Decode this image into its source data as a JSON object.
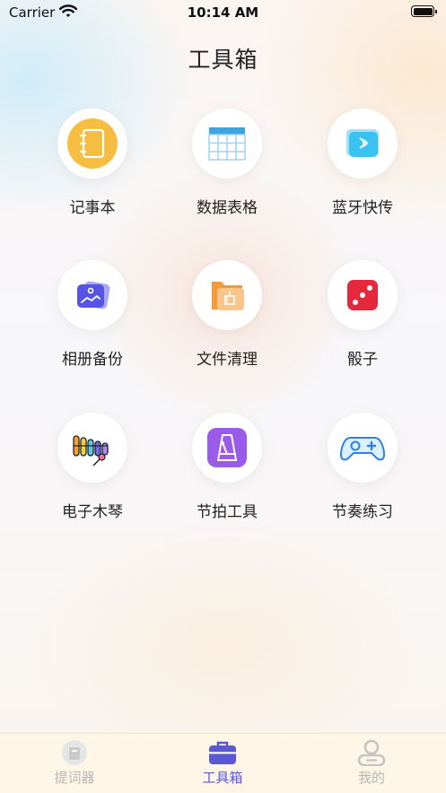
{
  "status_bar": {
    "carrier": "Carrier",
    "time": "10:14 AM"
  },
  "page": {
    "title": "工具箱"
  },
  "tools": [
    {
      "label": "记事本",
      "icon": "notebook-icon",
      "color": "#F5BE41"
    },
    {
      "label": "数据表格",
      "icon": "table-icon",
      "color": "#3FA3DE"
    },
    {
      "label": "蓝牙快传",
      "icon": "bluetooth-icon",
      "color": "#39C2F2"
    },
    {
      "label": "相册备份",
      "icon": "photo-album-icon",
      "color": "#5654E6"
    },
    {
      "label": "文件清理",
      "icon": "folder-clean-icon",
      "color": "#F39A3B"
    },
    {
      "label": "骰子",
      "icon": "dice-icon",
      "color": "#E5283B"
    },
    {
      "label": "电子木琴",
      "icon": "xylophone-icon",
      "color": "#F1A23A"
    },
    {
      "label": "节拍工具",
      "icon": "metronome-icon",
      "color": "#9A5BEA"
    },
    {
      "label": "节奏练习",
      "icon": "gamepad-icon",
      "color": "#2F7FE6"
    }
  ],
  "tab_bar": {
    "active_color": "#5B58D6",
    "tabs": [
      {
        "label": "提词器",
        "icon": "teleprompter-icon",
        "active": false
      },
      {
        "label": "工具箱",
        "icon": "toolbox-icon",
        "active": true
      },
      {
        "label": "我的",
        "icon": "profile-icon",
        "active": false
      }
    ]
  }
}
